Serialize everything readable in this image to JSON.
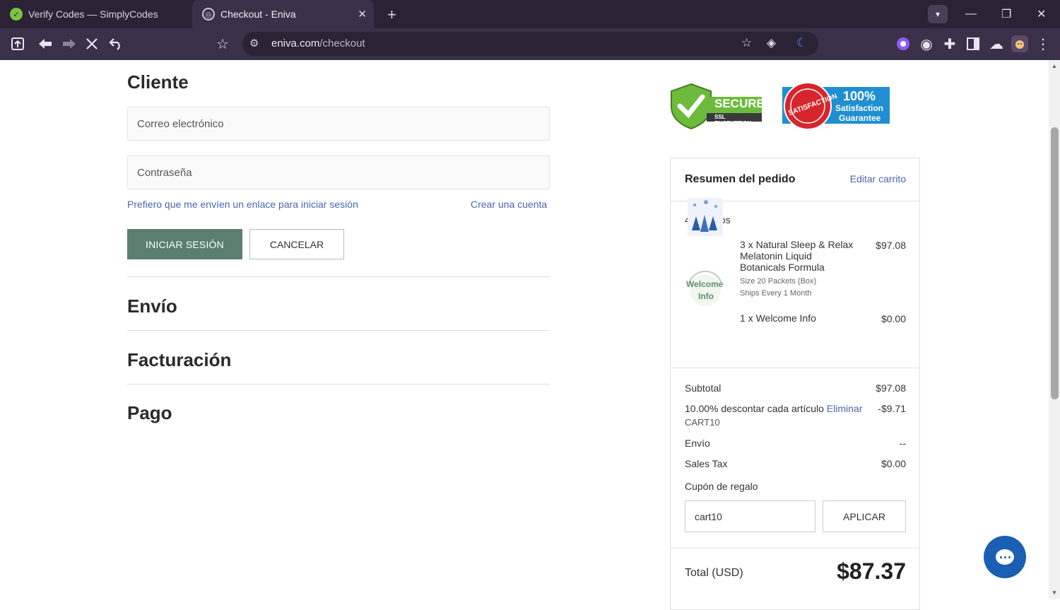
{
  "browser": {
    "tabs": [
      {
        "title": "Verify Codes — SimplyCodes",
        "active": false
      },
      {
        "title": "Checkout - Eniva",
        "active": true
      }
    ],
    "url_host": "eniva.com",
    "url_path": "/checkout"
  },
  "checkout": {
    "customer_heading": "Cliente",
    "email_placeholder": "Correo electrónico",
    "password_placeholder": "Contraseña",
    "magic_link_text": "Prefiero que me envíen un enlace para iniciar sesión",
    "create_account_text": "Crear una cuenta",
    "login_button": "INICIAR SESIÓN",
    "cancel_button": "CANCELAR",
    "shipping_heading": "Envío",
    "billing_heading": "Facturación",
    "payment_heading": "Pago"
  },
  "badges": {
    "secure_main": "SECURE",
    "secure_sub": "SSL ENCRYPTION",
    "sat_pct": "100%",
    "sat_line1": "Satisfaction",
    "sat_line2": "Guarantee",
    "sat_seal": "SATISFACTION"
  },
  "summary": {
    "title": "Resumen del pedido",
    "edit_cart": "Editar carrito",
    "item_count": "4 artículos",
    "items": [
      {
        "name": "3 x Natural Sleep & Relax Melatonin Liquid Botanicals Formula",
        "price": "$97.08",
        "detail1": "Size 20 Packets (Box)",
        "detail2": "Ships Every 1 Month"
      },
      {
        "name": "1 x Welcome Info",
        "price": "$0.00",
        "thumb_line1": "Welcome",
        "thumb_line2": "Info"
      }
    ],
    "subtotal_label": "Subtotal",
    "subtotal_value": "$97.08",
    "discount_label": "10.00% descontar cada artículo",
    "discount_remove": "Eliminar",
    "discount_value": "-$9.71",
    "discount_code": "CART10",
    "shipping_label": "Envío",
    "shipping_value": "--",
    "tax_label": "Sales Tax",
    "tax_value": "$0.00",
    "gift_coupon_label": "Cupón de regalo",
    "coupon_value": "cart10",
    "apply_button": "APLICAR",
    "total_label": "Total (USD)",
    "total_value": "$87.37"
  },
  "colors": {
    "primary_button": "#5a7f70",
    "link": "#4a66b0",
    "chat": "#1a5fb4"
  }
}
